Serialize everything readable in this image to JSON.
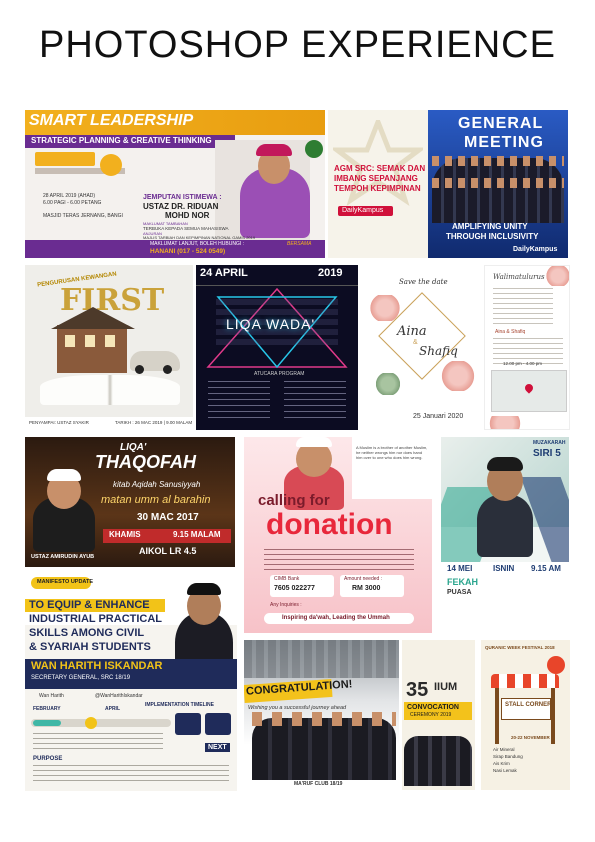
{
  "page": {
    "title": "PHOTOSHOP EXPERIENCE"
  },
  "posters": {
    "smart": {
      "heading": "SMART LEADERSHIP",
      "subheading": "STRATEGIC PLANNING & CREATIVE THINKING",
      "guest_label": "JEMPUTAN ISTIMEWA :",
      "guest_name_1": "USTAZ DR. RIDUAN",
      "guest_name_2": "MOHD NOR",
      "date": "28 APRIL 2019 (AHAD)",
      "time": "6.00 PAGI - 6.00 PETANG",
      "venue": "MASJID TERAS JERNANG, BANGI",
      "open_label": "MAKLUMAT TAMBAHAN",
      "open_text": "TERBUKA KEPADA SEMUA MAHASISWA",
      "org_label": "ANJURAN",
      "org_text": "MAJLIS TARBIAH DAN KEPIMPINAN NATIONAL GAMIS 2019",
      "contact_label": "MAKLUMAT LANJUT, BOLEH HUBUNGI :",
      "contact": "HANANI (017 - 524 0549)",
      "footer_tag": "BERSAMA",
      "brand": "GAMIS"
    },
    "agm": {
      "headline": "AGM SRC: SEMAK DAN IMBANG SEPANJANG TEMPOH KEPIMPINAN",
      "line1": "AGM SRC: SEMAK DAN",
      "line2": "IMBANG SEPANJANG",
      "line3": "TEMPOH KEPIMPINAN",
      "source": "DailyKampus",
      "title1": "GENERAL",
      "title2": "MEETING",
      "tagline1": "AMPLIFYING UNITY",
      "tagline2": "THROUGH INCLUSIVITY",
      "footer_source": "DailyKampus"
    },
    "first": {
      "small": "PENGURUSAN KEWANGAN",
      "big": "FIRST",
      "footer_left": "PENYAMPAI: USTAZ SYAKIR",
      "footer_right": "TARIKH : 26 MAC 2019 | 9.00 MALAM"
    },
    "liqa_wada": {
      "date_left": "24 APRIL",
      "date_right": "2019",
      "title": "LIQA WADA'",
      "program_label": "ATUCARA PROGRAM"
    },
    "aina": {
      "save": "Save the date",
      "name1": "Aina",
      "amp": "&",
      "name2": "Shafiq",
      "date": "25 Januari 2020"
    },
    "walimah": {
      "heading": "Walimatulurus",
      "names": "Aina & Shafiq",
      "date": "25 Januari 2020",
      "time": "12.00 pm - 4.00 pm"
    },
    "thaqofah": {
      "liqa": "LIQA'",
      "title": "THAQOFAH",
      "kitab": "kitab Aqidah Sanusiyyah",
      "matan": "matan umm al barahin",
      "date": "30 MAC 2017",
      "day": "KHAMIS",
      "time": "9.15 MALAM",
      "venue": "AIKOL LR 4.5",
      "speaker": "USTAZ AMIRUDIN AYUB"
    },
    "donation": {
      "calling": "calling for",
      "title": "donation",
      "quote": "A Muslim is a brother of another Muslim, he neither wrongs him nor does hand him over to one who does him wrong.",
      "cimb_label": "CIMB Bank",
      "account": "7605 022277",
      "amount_label": "Amount needed :",
      "amount": "RM 3000",
      "inquiries": "Any Inquiries :",
      "slogan": "Inspiring da'wah, Leading the Ummah"
    },
    "muzakarah": {
      "label": "MUZAKARAH",
      "series": "SIRI 5",
      "date": "14 MEI",
      "day": "ISNIN",
      "time": "9.15 AM",
      "topic": "FEKAH",
      "subtopic": "PUASA"
    },
    "manifesto": {
      "badge": "MANIFESTO UPDATE",
      "line1": "TO EQUIP & ENHANCE",
      "line2": "INDUSTRIAL PRACTICAL",
      "line3": "SKILLS AMONG CIVIL",
      "line4": "& SYARIAH STUDENTS",
      "name": "WAN HARITH ISKANDAR",
      "role": "SECRETARY GENERAL, SRC 18/19",
      "social1": "Wan Harith",
      "social2": "@WanHarithIskandar",
      "purpose": "PURPOSE",
      "timeline": "IMPLEMENTATION TIMELINE",
      "month1": "FEBRUARY",
      "month2": "APRIL",
      "next": "NEXT"
    },
    "congrats": {
      "title": "CONGRATULATION!",
      "wish": "Wishing you a successful journey ahead",
      "club": "MA'RUF CLUB 18/19",
      "number": "35",
      "org": "IIUM",
      "event": "CONVOCATION",
      "sub": "CEREMONY 2019"
    },
    "festival": {
      "title": "QURANIC WEEK FESTIVAL 2018",
      "stall": "STALL CORNER",
      "items": [
        "Air Mineral",
        "Sirap Bandung",
        "Ais Krim",
        "Nasi Lemak"
      ],
      "dates": "20-22 NOVEMBER"
    }
  },
  "colors": {
    "smart_purple": "#6a2c91",
    "smart_gold": "#f2b01e",
    "agm_blue": "#1a3c8f",
    "agm_red": "#d0103a",
    "liqa_bg": "#0c0c22",
    "donation_pink": "#f27e8f",
    "manifesto_yellow": "#f2c318",
    "convo_yellow": "#f3c21b"
  }
}
